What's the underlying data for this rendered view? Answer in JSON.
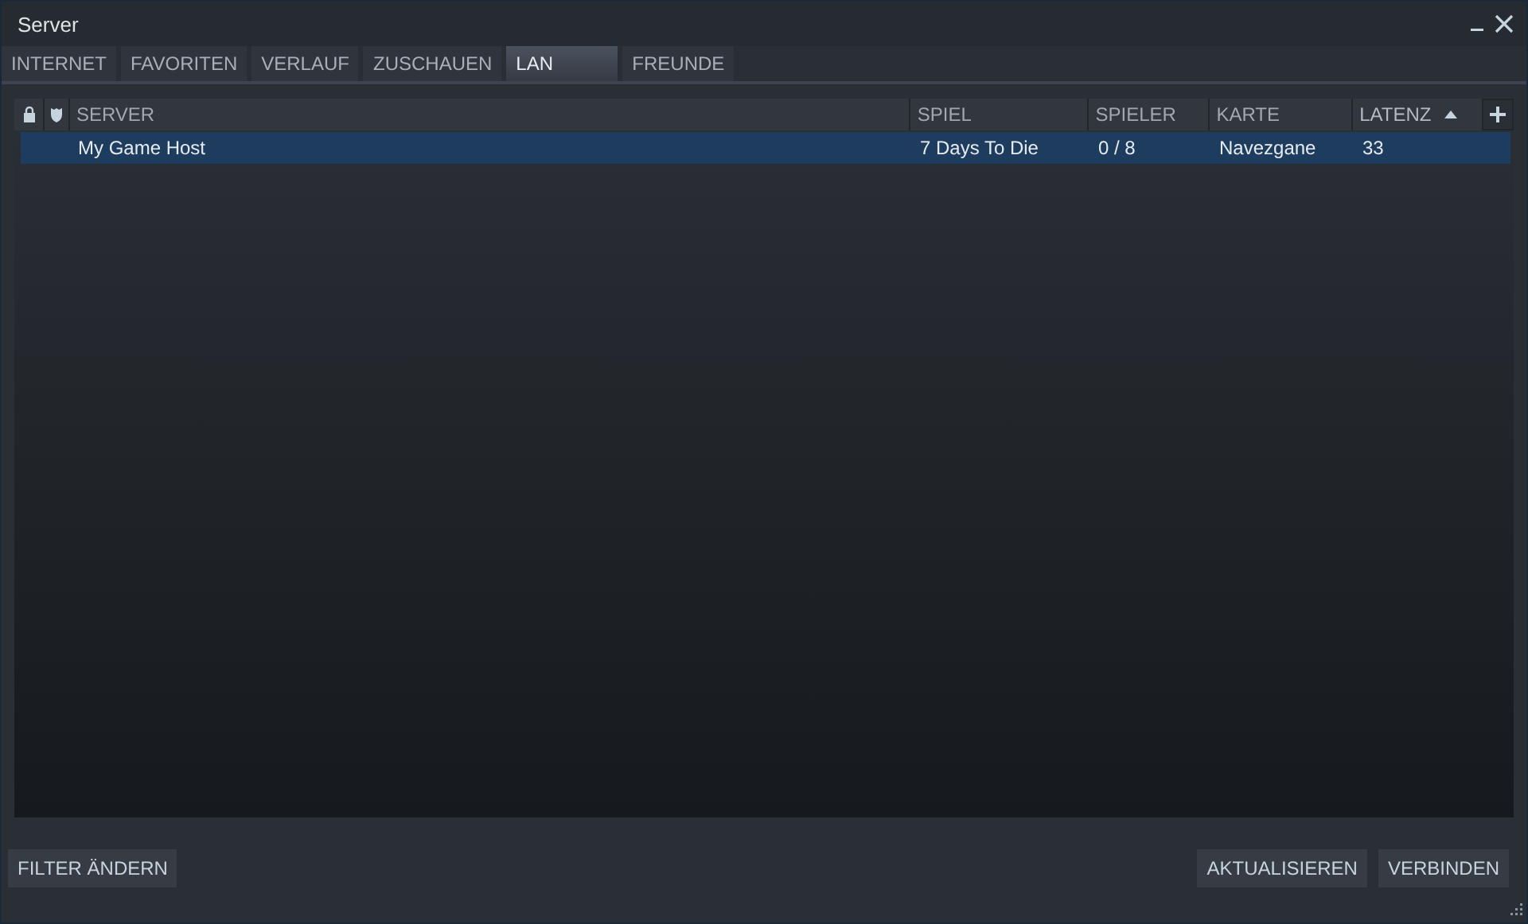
{
  "window": {
    "title": "Server"
  },
  "tabs": [
    {
      "label": "INTERNET",
      "selected": false
    },
    {
      "label": "FAVORITEN",
      "selected": false
    },
    {
      "label": "VERLAUF",
      "selected": false
    },
    {
      "label": "ZUSCHAUEN",
      "selected": false
    },
    {
      "label": "LAN",
      "selected": true
    },
    {
      "label": "FREUNDE",
      "selected": false
    }
  ],
  "table": {
    "columns": [
      {
        "label": "SERVER",
        "sorted": false
      },
      {
        "label": "SPIEL",
        "sorted": false
      },
      {
        "label": "SPIELER",
        "sorted": false
      },
      {
        "label": "KARTE",
        "sorted": false
      },
      {
        "label": "LATENZ",
        "sorted": true
      }
    ],
    "rows": [
      {
        "cells": [
          "My Game Host",
          "7 Days To Die",
          "0 / 8",
          "Navezgane",
          "33"
        ],
        "selected": true
      }
    ]
  },
  "buttons": {
    "left": [
      "FILTER ÄNDERN"
    ],
    "right": [
      "AKTUALISIEREN",
      "VERBINDEN"
    ]
  }
}
